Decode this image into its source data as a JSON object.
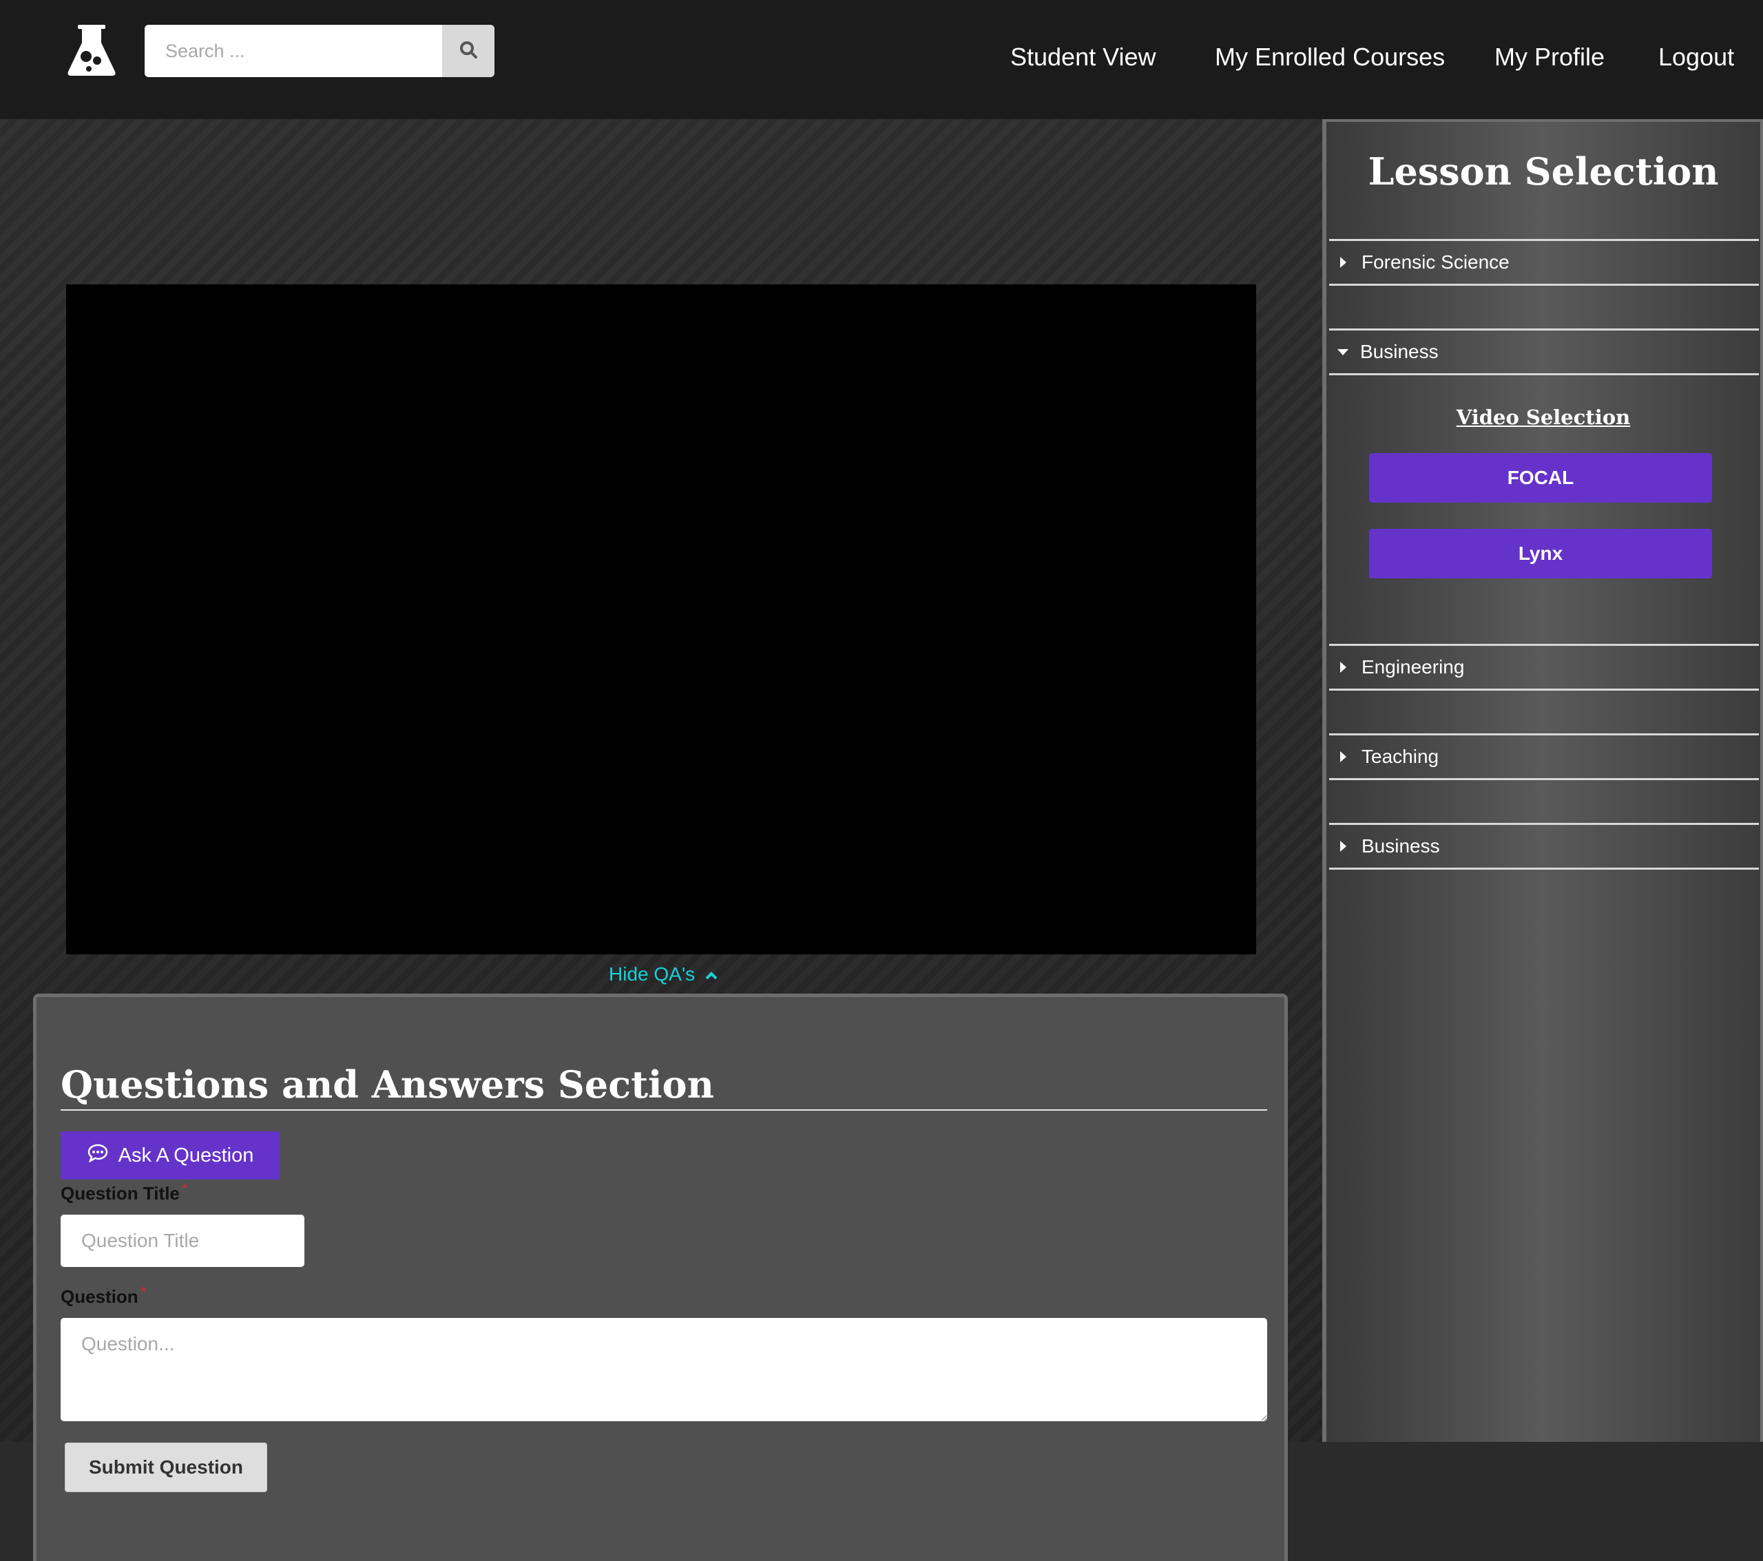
{
  "header": {
    "search": {
      "placeholder": "Search ..."
    },
    "nav": [
      "Student View",
      "My Enrolled Courses",
      "My Profile",
      "Logout"
    ]
  },
  "icons": {
    "logo": "flask-icon",
    "search": "search-icon",
    "hide": "chevron-up-icon",
    "ask": "comment-dots-icon",
    "collapsed": "caret-right-icon",
    "expanded": "caret-down-icon"
  },
  "main": {
    "hide_qa_label": "Hide QA's",
    "qa": {
      "title": "Questions and Answers Section",
      "ask_button": "Ask A Question",
      "question_title_label": "Question Title",
      "question_title_placeholder": "Question Title",
      "question_label": "Question",
      "question_placeholder": "Question...",
      "required_mark": "*",
      "submit_button": "Submit Question"
    }
  },
  "sidebar": {
    "title": "Lesson Selection",
    "lessons": [
      {
        "label": "Forensic Science",
        "expanded": false
      },
      {
        "label": "Business",
        "expanded": true
      },
      {
        "label": "Engineering",
        "expanded": false
      },
      {
        "label": "Teaching",
        "expanded": false
      },
      {
        "label": "Business",
        "expanded": false
      }
    ],
    "video_selection": {
      "heading": "Video Selection",
      "videos": [
        "FOCAL",
        "Lynx"
      ]
    }
  },
  "colors": {
    "accent_purple": "#6533c9",
    "link_cyan": "#18d2d9",
    "header_bg": "#1b1b1b",
    "panel_bg": "#505050"
  }
}
